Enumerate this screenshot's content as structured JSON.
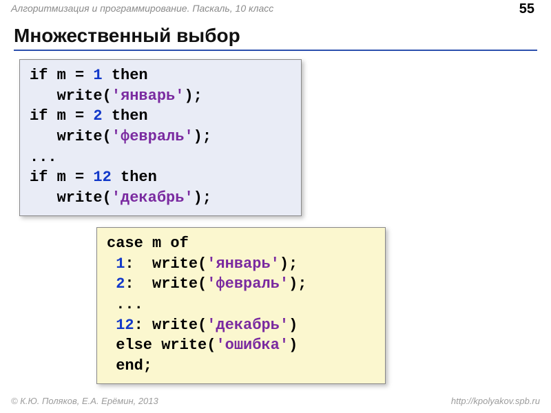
{
  "header": {
    "breadcrumb": "Алгоритмизация и программирование. Паскаль, 10 класс",
    "page_number": "55"
  },
  "title": "Множественный выбор",
  "code_if": {
    "lines": [
      {
        "segments": [
          {
            "t": "if m = ",
            "c": "kw"
          },
          {
            "t": "1",
            "c": "num"
          },
          {
            "t": " then",
            "c": "kw"
          }
        ]
      },
      {
        "segments": [
          {
            "t": "   write(",
            "c": "kw"
          },
          {
            "t": "'январь'",
            "c": "str"
          },
          {
            "t": ");",
            "c": "kw"
          }
        ]
      },
      {
        "segments": [
          {
            "t": "if m = ",
            "c": "kw"
          },
          {
            "t": "2",
            "c": "num"
          },
          {
            "t": " then",
            "c": "kw"
          }
        ]
      },
      {
        "segments": [
          {
            "t": "   write(",
            "c": "kw"
          },
          {
            "t": "'февраль'",
            "c": "str"
          },
          {
            "t": ");",
            "c": "kw"
          }
        ]
      },
      {
        "segments": [
          {
            "t": "...",
            "c": "kw"
          }
        ]
      },
      {
        "segments": [
          {
            "t": "if m = ",
            "c": "kw"
          },
          {
            "t": "12",
            "c": "num"
          },
          {
            "t": " then",
            "c": "kw"
          }
        ]
      },
      {
        "segments": [
          {
            "t": "   write(",
            "c": "kw"
          },
          {
            "t": "'декабрь'",
            "c": "str"
          },
          {
            "t": ");",
            "c": "kw"
          }
        ]
      }
    ]
  },
  "code_case": {
    "lines": [
      {
        "segments": [
          {
            "t": "case m of",
            "c": "kw"
          }
        ]
      },
      {
        "segments": [
          {
            "t": " ",
            "c": "kw"
          },
          {
            "t": "1",
            "c": "num"
          },
          {
            "t": ":  write(",
            "c": "kw"
          },
          {
            "t": "'январь'",
            "c": "str"
          },
          {
            "t": ");",
            "c": "kw"
          }
        ]
      },
      {
        "segments": [
          {
            "t": " ",
            "c": "kw"
          },
          {
            "t": "2",
            "c": "num"
          },
          {
            "t": ":  write(",
            "c": "kw"
          },
          {
            "t": "'февраль'",
            "c": "str"
          },
          {
            "t": ");",
            "c": "kw"
          }
        ]
      },
      {
        "segments": [
          {
            "t": " ...",
            "c": "kw"
          }
        ]
      },
      {
        "segments": [
          {
            "t": " ",
            "c": "kw"
          },
          {
            "t": "12",
            "c": "num"
          },
          {
            "t": ": write(",
            "c": "kw"
          },
          {
            "t": "'декабрь'",
            "c": "str"
          },
          {
            "t": ")",
            "c": "kw"
          }
        ]
      },
      {
        "segments": [
          {
            "t": " else write(",
            "c": "kw"
          },
          {
            "t": "'ошибка'",
            "c": "str"
          },
          {
            "t": ")",
            "c": "kw"
          }
        ]
      },
      {
        "segments": [
          {
            "t": " end;",
            "c": "kw"
          }
        ]
      }
    ]
  },
  "footer": {
    "copyright": "© К.Ю. Поляков, Е.А. Ерёмин, 2013",
    "url": "http://kpolyakov.spb.ru"
  }
}
